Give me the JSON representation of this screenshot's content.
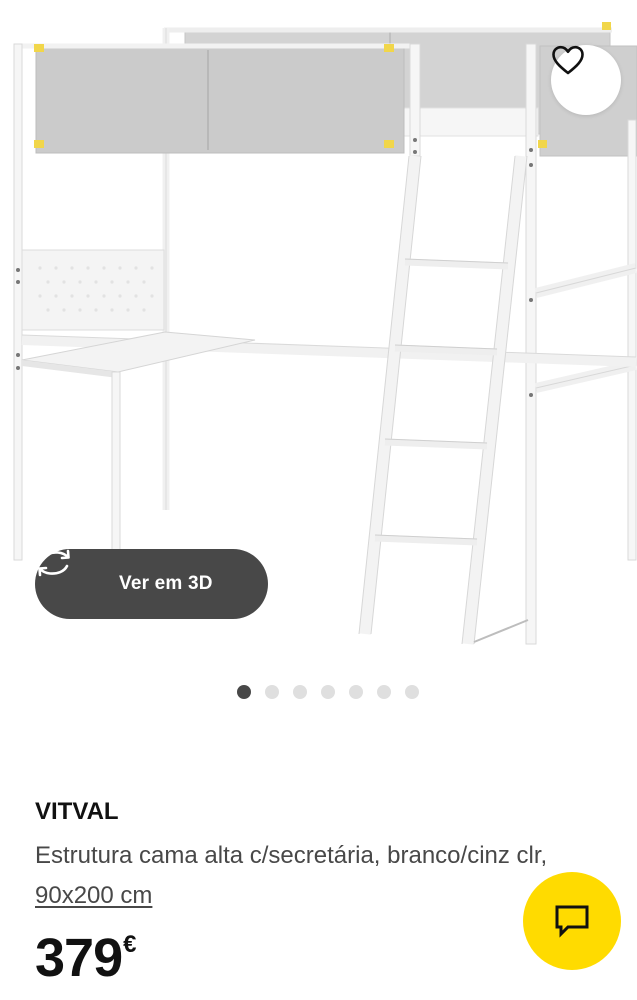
{
  "gallery": {
    "image_label": "product-photo-loft-bed",
    "view3d_label": "Ver em 3D",
    "view3d_icon": "rotate-3d-icon",
    "favourite_icon": "heart-icon",
    "dots": [
      {
        "active": true
      },
      {
        "active": false
      },
      {
        "active": false
      },
      {
        "active": false
      },
      {
        "active": false
      },
      {
        "active": false
      },
      {
        "active": false
      }
    ]
  },
  "product": {
    "name": "VITVAL",
    "description": "Estrutura cama alta c/secretária, branco/cinz clr, ",
    "size": "90x200 cm",
    "price": "379",
    "currency": "€"
  },
  "chat": {
    "icon": "chat-icon"
  },
  "colors": {
    "chat_button": "#ffdb00",
    "view3d_button": "#484848",
    "active_dot": "#484848",
    "inactive_dot": "#dfdfdf"
  }
}
